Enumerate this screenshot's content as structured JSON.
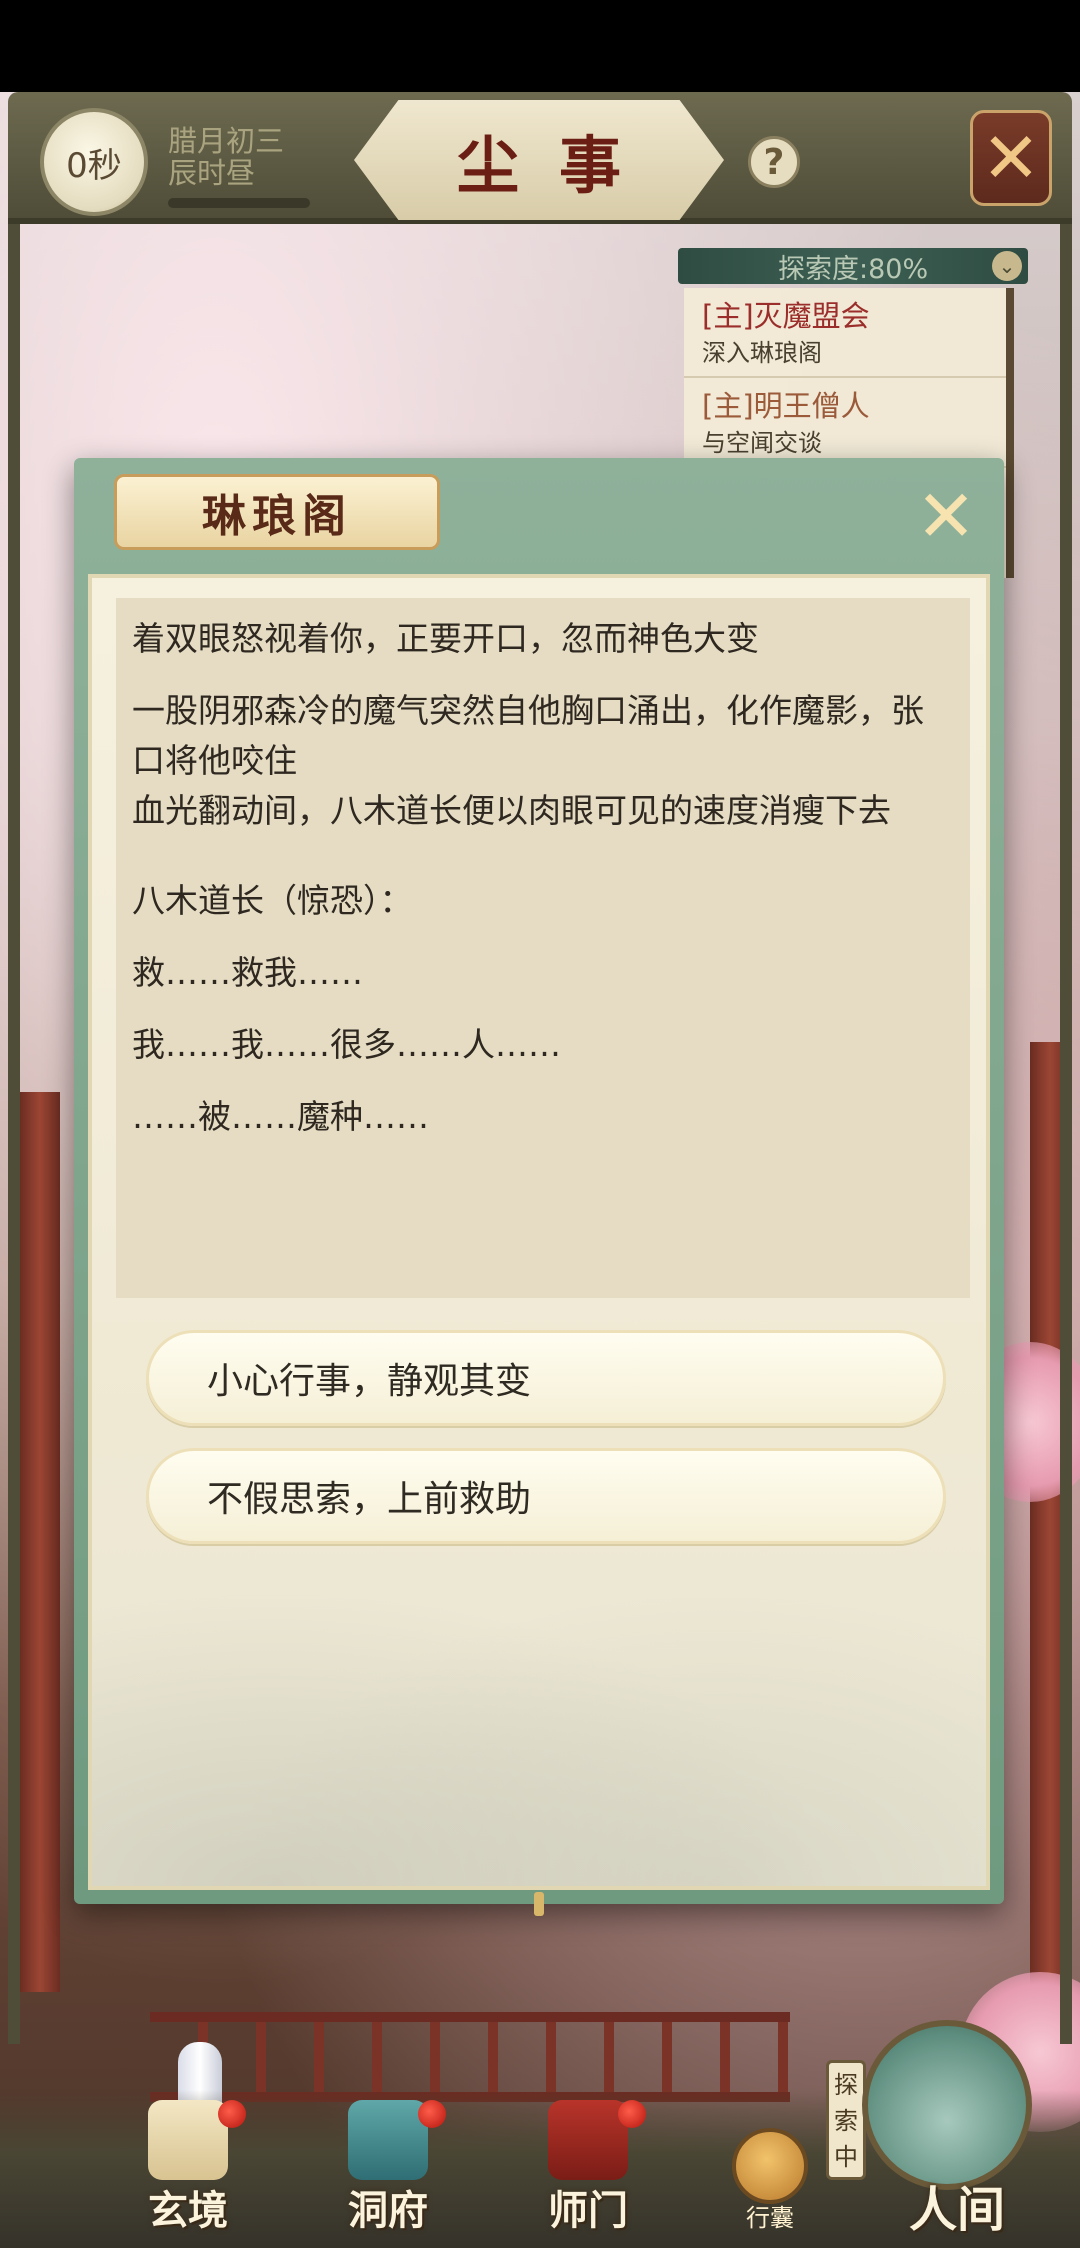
{
  "header": {
    "timer": "0秒",
    "date_line1": "腊月初三",
    "date_line2": "辰时昼",
    "title": "尘事",
    "help_label": "?"
  },
  "quest_tracker": {
    "header_label": "探索度:80%",
    "exploration_percent": 80,
    "quests": [
      {
        "name": "[主]灭魔盟会",
        "desc": "深入琳琅阁"
      },
      {
        "name": "[主]明王僧人",
        "desc": "与空闻交谈"
      }
    ]
  },
  "dialog": {
    "title": "琳琅阁",
    "story": [
      "着双眼怒视着你，正要开口，忽而神色大变",
      "一股阴邪森冷的魔气突然自他胸口涌出，化作魔影，张口将他咬住",
      "血光翻动间，八木道长便以肉眼可见的速度消瘦下去",
      "八木道长（惊恐）：",
      "救……救我……",
      "我……我……很多……人……",
      "……被……魔种……"
    ],
    "choices": [
      "小心行事，静观其变",
      "不假思索，上前救助"
    ]
  },
  "nav": {
    "items": [
      {
        "label": "玄境"
      },
      {
        "label": "洞府"
      },
      {
        "label": "师门"
      }
    ],
    "bag_label": "行囊",
    "exploring_tag": "探索中",
    "world_label": "人间"
  }
}
